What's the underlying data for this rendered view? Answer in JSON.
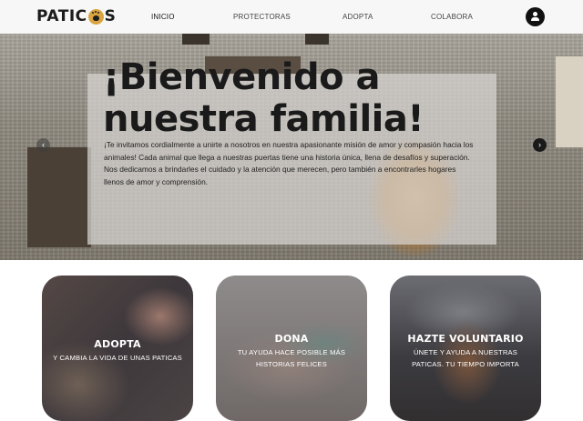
{
  "brand": {
    "logo_text": "PATICAS"
  },
  "nav": {
    "items": [
      {
        "label": "INICIO",
        "active": true
      },
      {
        "label": "PROTECTORAS",
        "active": false
      },
      {
        "label": "ADOPTA",
        "active": false
      },
      {
        "label": "COLABORA",
        "active": false
      }
    ],
    "user_icon": "user-icon"
  },
  "hero": {
    "title_line1": "¡Bienvenido a",
    "title_line2": "nuestra familia!",
    "body": "¡Te invitamos cordialmente a unirte a nosotros en nuestra apasionante misión de amor y compasión hacia los animales! Cada animal que llega a nuestras puertas tiene una historia única, llena de desafíos y superación. Nos dedicamos a brindarles el cuidado y la atención que merecen, pero también a encontrarles hogares llenos de amor y comprensión.",
    "prev_icon": "chevron-left-icon",
    "next_icon": "chevron-right-icon"
  },
  "cards": [
    {
      "title": "ADOPTA",
      "subtitle": "Y CAMBIA LA VIDA DE UNAS PATICAS"
    },
    {
      "title": "DONA",
      "subtitle": "TU AYUDA HACE POSIBLE MÁS HISTORIAS FELICES"
    },
    {
      "title": "HAZTE VOLUNTARIO",
      "subtitle": "ÚNETE Y AYUDA A NUESTRAS PATICAS. TU TIEMPO IMPORTA"
    }
  ],
  "colors": {
    "brand_accent": "#d9a441",
    "nav_bg": "#f7f7f8",
    "text_dark": "#1a1a1a"
  }
}
